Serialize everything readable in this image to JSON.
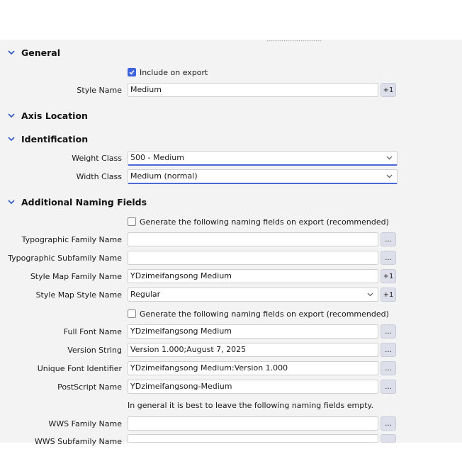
{
  "sections": {
    "general": "General",
    "axis_location": "Axis Location",
    "identification": "Identification",
    "additional_naming": "Additional Naming Fields"
  },
  "general": {
    "include_on_export": "Include on export",
    "include_on_export_checked": true,
    "style_name_label": "Style Name",
    "style_name_value": "Medium",
    "style_name_button": "+1"
  },
  "identification": {
    "weight_class_label": "Weight Class",
    "weight_class_value": "500 - Medium",
    "width_class_label": "Width Class",
    "width_class_value": "Medium (normal)"
  },
  "naming": {
    "generate_label": "Generate the following naming fields on export (recommended)",
    "typo_family_label": "Typographic Family Name",
    "typo_family_value": "",
    "typo_subfamily_label": "Typographic Subfamily Name",
    "typo_subfamily_value": "",
    "style_map_family_label": "Style Map Family Name",
    "style_map_family_value": "YDzimeifangsong Medium",
    "style_map_style_label": "Style Map Style Name",
    "style_map_style_value": "Regular",
    "generate_label_2": "Generate the following naming fields on export (recommended)",
    "full_font_label": "Full Font Name",
    "full_font_value": "YDzimeifangsong Medium",
    "version_label": "Version String",
    "version_value": "Version 1.000;August 7, 2025",
    "unique_id_label": "Unique Font Identifier",
    "unique_id_value": "YDzimeifangsong Medium:Version 1.000",
    "postscript_label": "PostScript Name",
    "postscript_value": "YDzimeifangsong-Medium",
    "empty_note": "In general it is best to leave the following naming fields empty.",
    "wws_family_label": "WWS Family Name",
    "wws_family_value": "",
    "wws_subfamily_label": "WWS Subfamily Name",
    "wws_subfamily_value": "",
    "more_button": "...",
    "plus_one_button": "+1"
  },
  "colors": {
    "accent": "#3d63dd",
    "panel_bg": "#f3f3f4",
    "button_bg": "#dde0ea"
  }
}
